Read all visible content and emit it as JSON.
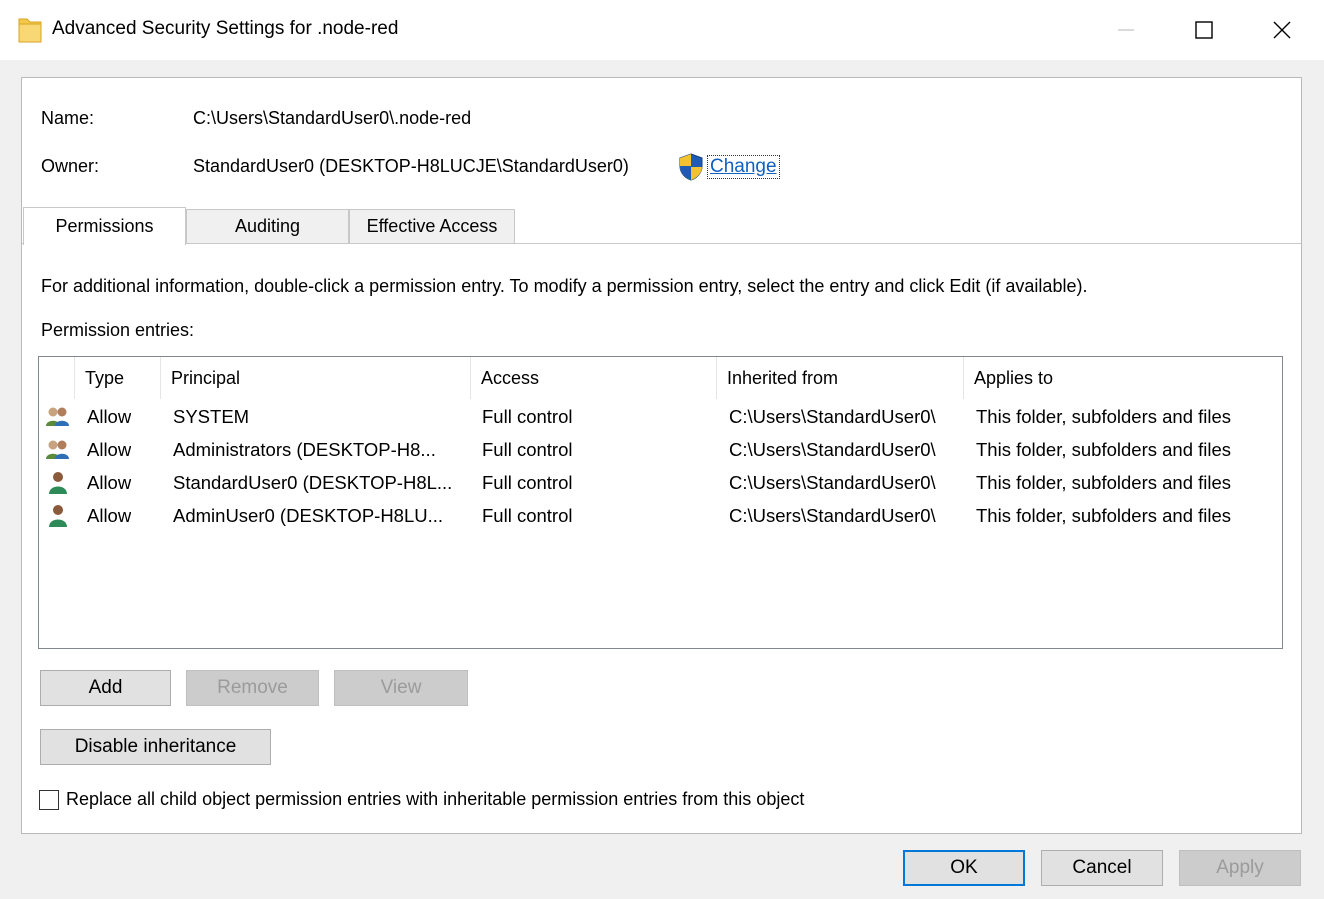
{
  "window": {
    "title": "Advanced Security Settings for .node-red",
    "icon": "folder-icon",
    "controls": [
      "minimize-icon",
      "maximize-icon",
      "close-icon"
    ]
  },
  "object": {
    "name_label": "Name:",
    "name_value": "C:\\Users\\StandardUser0\\.node-red",
    "owner_label": "Owner:",
    "owner_value": "StandardUser0 (DESKTOP-H8LUCJE\\StandardUser0)",
    "change_link": "Change",
    "link_color": "#1060c0"
  },
  "tabs": [
    {
      "label": "Permissions",
      "active": true
    },
    {
      "label": "Auditing",
      "active": false
    },
    {
      "label": "Effective Access",
      "active": false
    }
  ],
  "info_text": "For additional information, double-click a permission entry. To modify a permission entry, select the entry and click Edit (if available).",
  "entries_label": "Permission entries:",
  "table": {
    "columns": [
      "Type",
      "Principal",
      "Access",
      "Inherited from",
      "Applies to"
    ],
    "rows": [
      {
        "icon": "group-icon",
        "type": "Allow",
        "principal": "SYSTEM",
        "access": "Full control",
        "inherited": "C:\\Users\\StandardUser0\\",
        "applies": "This folder, subfolders and files"
      },
      {
        "icon": "group-icon",
        "type": "Allow",
        "principal": "Administrators (DESKTOP-H8...",
        "access": "Full control",
        "inherited": "C:\\Users\\StandardUser0\\",
        "applies": "This folder, subfolders and files"
      },
      {
        "icon": "user-icon",
        "type": "Allow",
        "principal": "StandardUser0 (DESKTOP-H8L...",
        "access": "Full control",
        "inherited": "C:\\Users\\StandardUser0\\",
        "applies": "This folder, subfolders and files"
      },
      {
        "icon": "user-icon",
        "type": "Allow",
        "principal": "AdminUser0 (DESKTOP-H8LU...",
        "access": "Full control",
        "inherited": "C:\\Users\\StandardUser0\\",
        "applies": "This folder, subfolders and files"
      }
    ]
  },
  "buttons": {
    "add": "Add",
    "remove": "Remove",
    "view": "View",
    "disable_inheritance": "Disable inheritance",
    "ok": "OK",
    "cancel": "Cancel",
    "apply": "Apply"
  },
  "checkbox": {
    "label": "Replace all child object permission entries with inheritable permission entries from this object",
    "checked": false
  }
}
